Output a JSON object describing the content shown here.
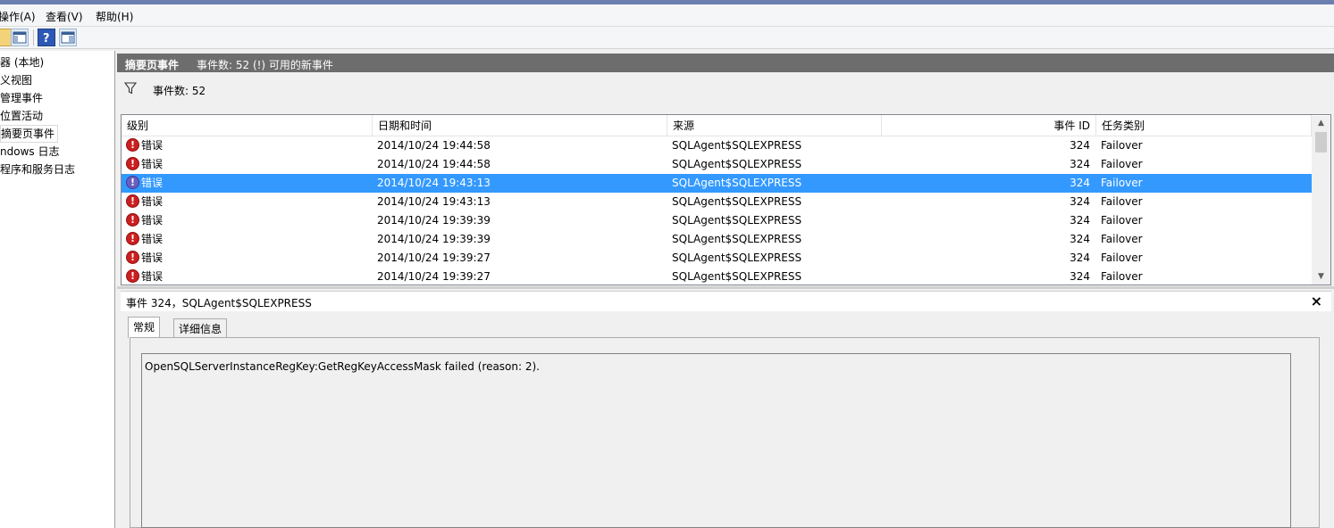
{
  "menu": [
    "操作(A)",
    "查看(V)",
    "帮助(H)"
  ],
  "tree": {
    "items": [
      "器 (本地)",
      "义视图",
      "管理事件",
      "位置活动",
      "摘要页事件",
      "ndows 日志",
      "程序和服务日志"
    ],
    "selected_index": 4
  },
  "header": {
    "title": "摘要页事件",
    "count_text": "事件数: 52 (!) 可用的新事件"
  },
  "filter": {
    "text": "事件数: 52"
  },
  "table": {
    "columns": [
      "级别",
      "日期和时间",
      "来源",
      "事件 ID",
      "任务类别"
    ],
    "rows": [
      {
        "level": "错误",
        "datetime": "2014/10/24 19:44:58",
        "source": "SQLAgent$SQLEXPRESS",
        "event_id": "324",
        "category": "Failover"
      },
      {
        "level": "错误",
        "datetime": "2014/10/24 19:44:58",
        "source": "SQLAgent$SQLEXPRESS",
        "event_id": "324",
        "category": "Failover"
      },
      {
        "level": "错误",
        "datetime": "2014/10/24 19:43:13",
        "source": "SQLAgent$SQLEXPRESS",
        "event_id": "324",
        "category": "Failover"
      },
      {
        "level": "错误",
        "datetime": "2014/10/24 19:43:13",
        "source": "SQLAgent$SQLEXPRESS",
        "event_id": "324",
        "category": "Failover"
      },
      {
        "level": "错误",
        "datetime": "2014/10/24 19:39:39",
        "source": "SQLAgent$SQLEXPRESS",
        "event_id": "324",
        "category": "Failover"
      },
      {
        "level": "错误",
        "datetime": "2014/10/24 19:39:39",
        "source": "SQLAgent$SQLEXPRESS",
        "event_id": "324",
        "category": "Failover"
      },
      {
        "level": "错误",
        "datetime": "2014/10/24 19:39:27",
        "source": "SQLAgent$SQLEXPRESS",
        "event_id": "324",
        "category": "Failover"
      },
      {
        "level": "错误",
        "datetime": "2014/10/24 19:39:27",
        "source": "SQLAgent$SQLEXPRESS",
        "event_id": "324",
        "category": "Failover"
      }
    ],
    "selected_index": 2
  },
  "detail": {
    "title": "事件 324，SQLAgent$SQLEXPRESS",
    "close": "×",
    "tabs": [
      "常规",
      "详细信息"
    ],
    "active_tab": 0,
    "message": "OpenSQLServerInstanceRegKey:GetRegKeyAccessMask failed (reason: 2)."
  },
  "colors": {
    "selection": "#3399ff",
    "header_bar": "#6d6d6d",
    "error_icon": "#cc1f1f"
  }
}
